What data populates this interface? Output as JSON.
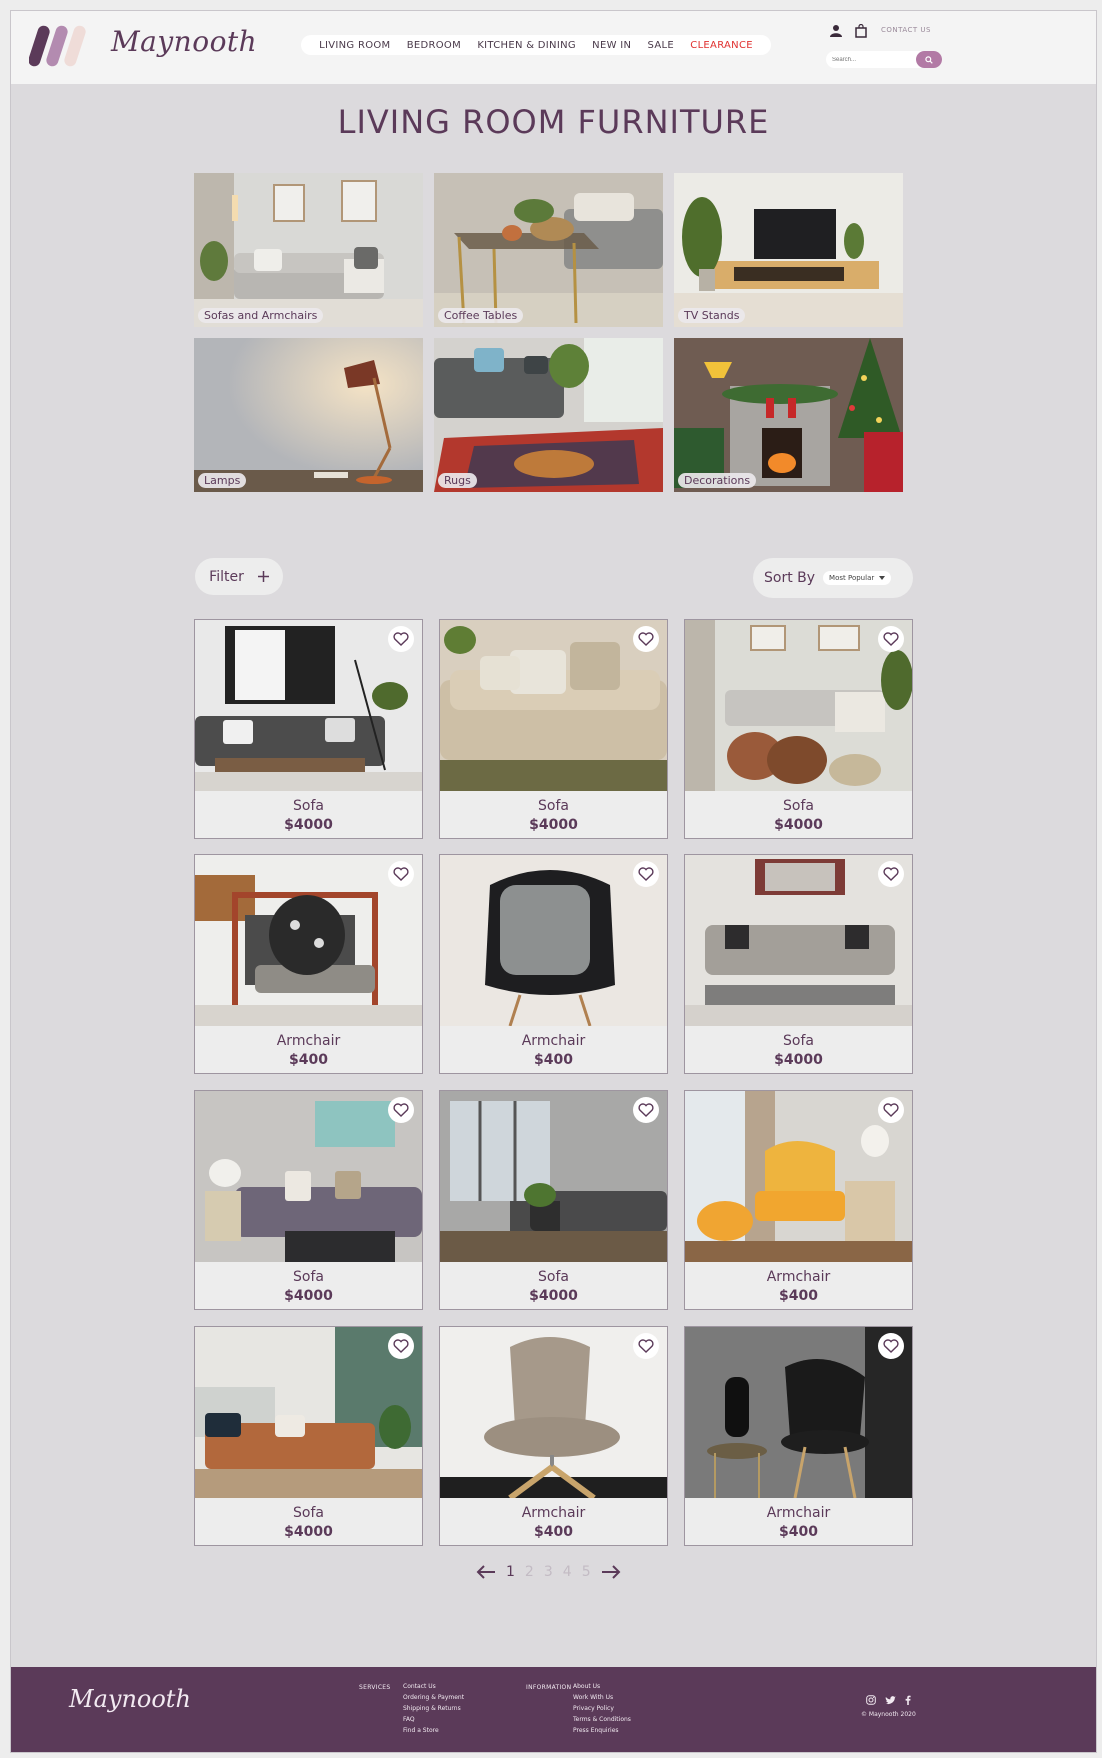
{
  "brand": {
    "name": "Maynooth",
    "colors": {
      "primary": "#5b3a59",
      "accent": "#b27aa5",
      "sale": "#e0302f",
      "background": "#dcdadd"
    }
  },
  "header": {
    "nav": [
      "LIVING ROOM",
      "BEDROOM",
      "KITCHEN & DINING",
      "NEW IN",
      "SALE",
      "CLEARANCE"
    ],
    "contact_label": "CONTACT US",
    "search_placeholder": "Search...",
    "icons": [
      "user-icon",
      "shopping-bag-icon",
      "search-icon"
    ]
  },
  "page": {
    "title": "LIVING ROOM FURNITURE"
  },
  "categories": [
    {
      "label": "Sofas and Armchairs"
    },
    {
      "label": "Coffee Tables"
    },
    {
      "label": "TV Stands"
    },
    {
      "label": "Lamps"
    },
    {
      "label": "Rugs"
    },
    {
      "label": "Decorations"
    }
  ],
  "controls": {
    "filter_label": "Filter",
    "sort_label": "Sort By",
    "sort_value": "Most Popular"
  },
  "products": [
    {
      "name": "Sofa",
      "price": "$4000"
    },
    {
      "name": "Sofa",
      "price": "$4000"
    },
    {
      "name": "Sofa",
      "price": "$4000"
    },
    {
      "name": "Armchair",
      "price": "$400"
    },
    {
      "name": "Armchair",
      "price": "$400"
    },
    {
      "name": "Sofa",
      "price": "$4000"
    },
    {
      "name": "Sofa",
      "price": "$4000"
    },
    {
      "name": "Sofa",
      "price": "$4000"
    },
    {
      "name": "Armchair",
      "price": "$400"
    },
    {
      "name": "Sofa",
      "price": "$4000"
    },
    {
      "name": "Armchair",
      "price": "$400"
    },
    {
      "name": "Armchair",
      "price": "$400"
    }
  ],
  "pagination": {
    "pages": [
      "1",
      "2",
      "3",
      "4",
      "5"
    ],
    "current": "1"
  },
  "footer": {
    "services_heading": "SERVICES",
    "services": [
      "Contact Us",
      "Ordering & Payment",
      "Shipping & Returns",
      "FAQ",
      "Find a Store"
    ],
    "information_heading": "INFORMATION",
    "information": [
      "About Us",
      "Work With Us",
      "Privacy Policy",
      "Terms & Conditions",
      "Press Enquiries"
    ],
    "social_icons": [
      "instagram-icon",
      "twitter-icon",
      "facebook-icon"
    ],
    "copyright": "© Maynooth 2020"
  }
}
